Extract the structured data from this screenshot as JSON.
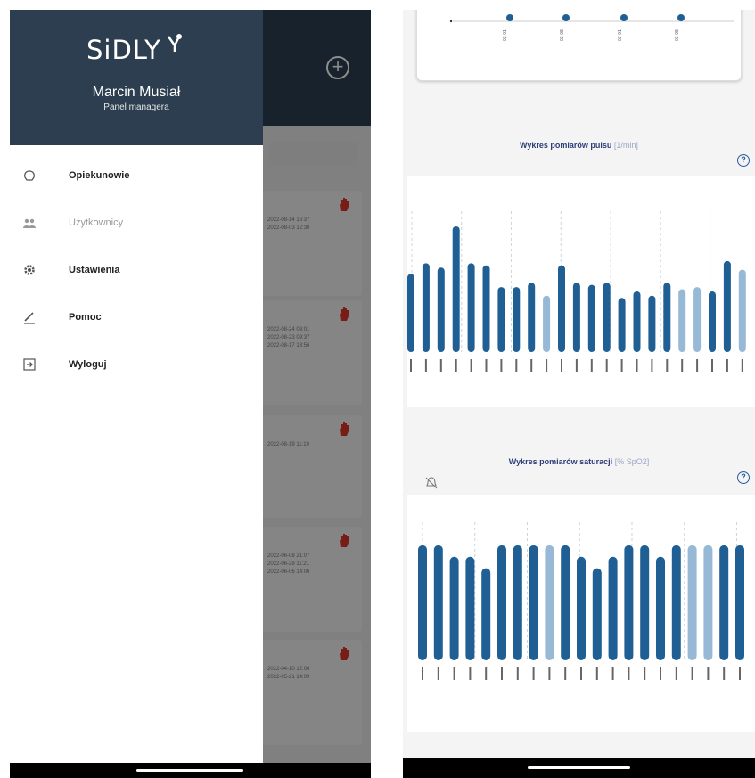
{
  "left_screen": {
    "brand": "SiDLY",
    "user_name": "Marcin Musiał",
    "user_role": "Panel managera",
    "menu": [
      {
        "label": "Opiekunowie",
        "icon": "hand-heart-icon",
        "enabled": true
      },
      {
        "label": "Użytkownicy",
        "icon": "users-icon",
        "enabled": false
      },
      {
        "label": "Ustawienia",
        "icon": "gear-icon",
        "enabled": true
      },
      {
        "label": "Pomoc",
        "icon": "pencil-icon",
        "enabled": true
      },
      {
        "label": "Wyloguj",
        "icon": "logout-icon",
        "enabled": true
      }
    ],
    "background_cards": [
      {
        "timestamps": [
          "2022-08-14 16:37",
          "2022-08-03 12:30"
        ]
      },
      {
        "timestamps": [
          "2022-08-24 09:01",
          "2022-08-23 09:37",
          "2022-08-17 13:56"
        ]
      },
      {
        "timestamps": [
          "2022-08-19 11:10"
        ]
      },
      {
        "timestamps": [
          "2022-06-08 21:07",
          "2022-06-29 11:21",
          "2022-06-06 14:06"
        ]
      },
      {
        "timestamps": [
          "2022-04-10 12:06",
          "2022-05-21 14:09"
        ]
      }
    ],
    "colors": {
      "header": "#2c3e50",
      "alert": "#d9342b"
    }
  },
  "right_screen": {
    "pulse_chart": {
      "title": "Wykres pomiarów pulsu",
      "unit": "[1/min]"
    },
    "saturation_chart": {
      "title": "Wykres pomiarów saturacji",
      "unit": "[% SpO2]"
    },
    "colors": {
      "bar_dark": "#1f5f94",
      "bar_light": "#97b9d6",
      "title": "#2c3e7a"
    }
  },
  "chart_data": [
    {
      "type": "bar",
      "title": "Wykres pomiarów pulsu [1/min]",
      "values": [
        96,
        101,
        99,
        118,
        101,
        100,
        90,
        90,
        92,
        86,
        100,
        92,
        91,
        92,
        85,
        88,
        86,
        92,
        89,
        90,
        88,
        102,
        98
      ],
      "highlight": [
        false,
        false,
        false,
        false,
        false,
        false,
        false,
        false,
        false,
        true,
        false,
        false,
        false,
        false,
        false,
        false,
        false,
        false,
        true,
        true,
        false,
        false,
        true
      ],
      "ylim": [
        60,
        125
      ]
    },
    {
      "type": "bar",
      "title": "Wykres pomiarów saturacji [% SpO2]",
      "values": [
        98,
        98,
        97,
        97,
        96,
        98,
        98,
        98,
        98,
        98,
        97,
        96,
        97,
        98,
        98,
        97,
        98,
        98,
        98,
        98,
        98
      ],
      "highlight": [
        false,
        false,
        false,
        false,
        false,
        false,
        false,
        false,
        true,
        false,
        false,
        false,
        false,
        false,
        false,
        false,
        false,
        true,
        true,
        false,
        false
      ],
      "ylim": [
        88,
        100
      ]
    }
  ]
}
